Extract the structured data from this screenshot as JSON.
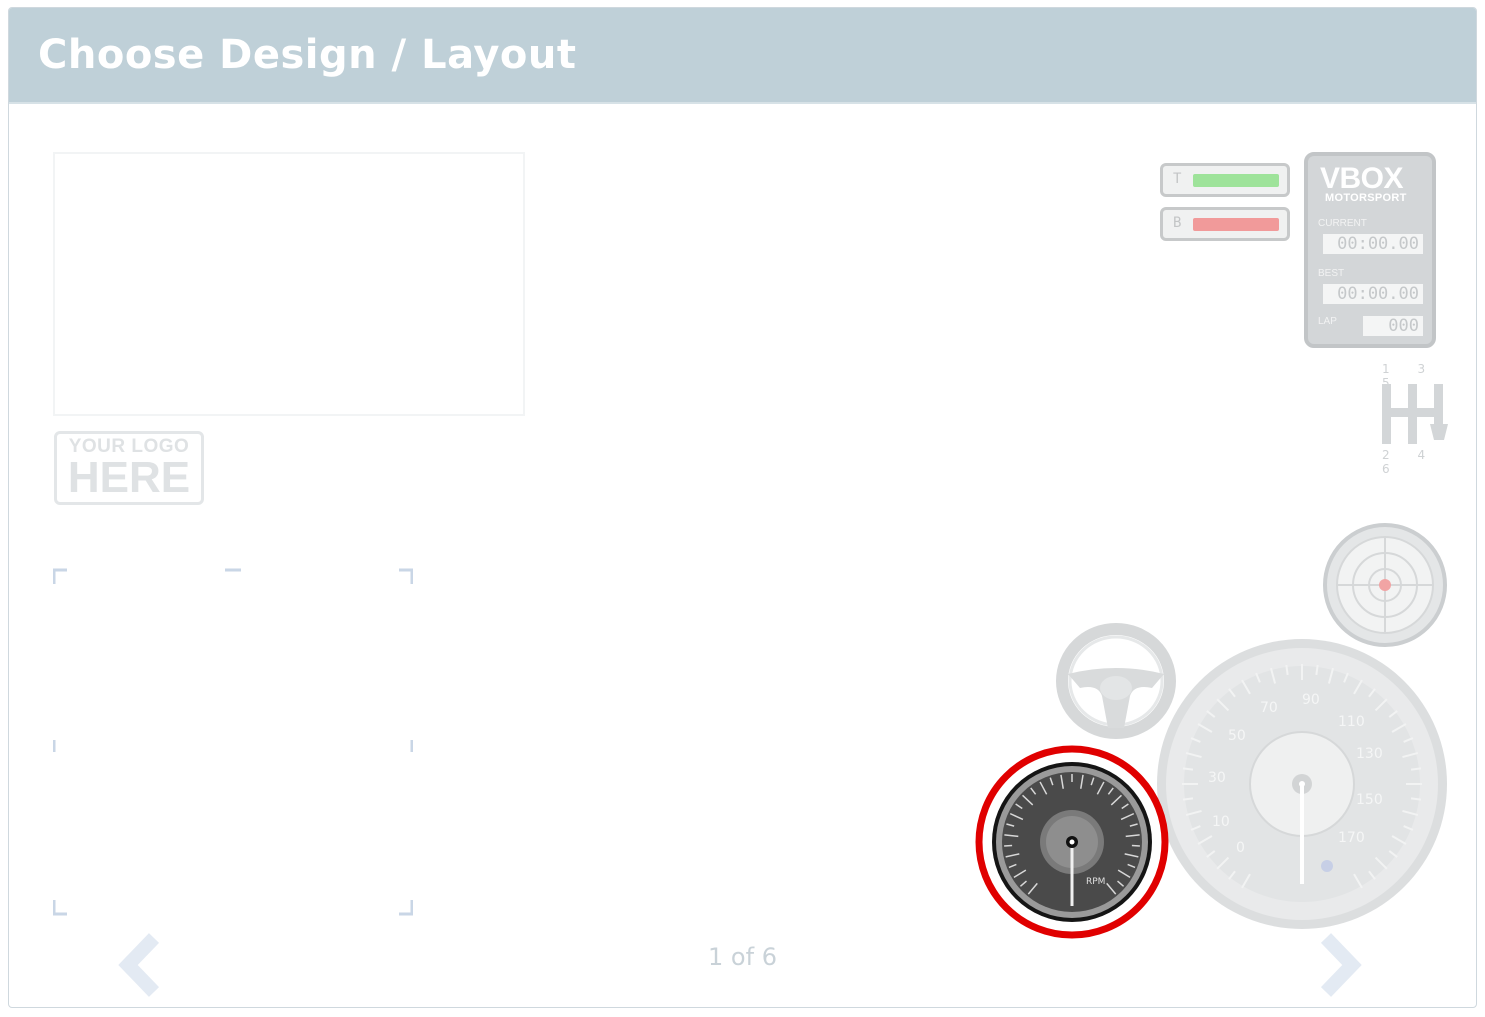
{
  "header": {
    "title": "Choose Design / Layout"
  },
  "logo": {
    "line1": "YOUR LOGO",
    "line2": "HERE"
  },
  "pagination": {
    "text": "1 of 6"
  },
  "overlay": {
    "bars": [
      {
        "label": "T",
        "color": "#9ee39a"
      },
      {
        "label": "B",
        "color": "#f19a9a"
      }
    ],
    "vbox": {
      "brand": "VBOX",
      "subtitle": "MOTORSPORT",
      "current_label": "CURRENT",
      "current_value": "00:00.00",
      "best_label": "BEST",
      "best_value": "00:00.00",
      "lap_label": "LAP",
      "lap_value": "000"
    },
    "gear_top": "1 3 5",
    "gear_bottom": "2 4 6",
    "speedo_ticks": [
      "0",
      "10",
      "30",
      "50",
      "70",
      "90",
      "110",
      "130",
      "150",
      "170"
    ],
    "tacho_unit": "RPM"
  },
  "colors": {
    "selection_ring": "#e00000",
    "header_bg": "#bfd0d8"
  }
}
